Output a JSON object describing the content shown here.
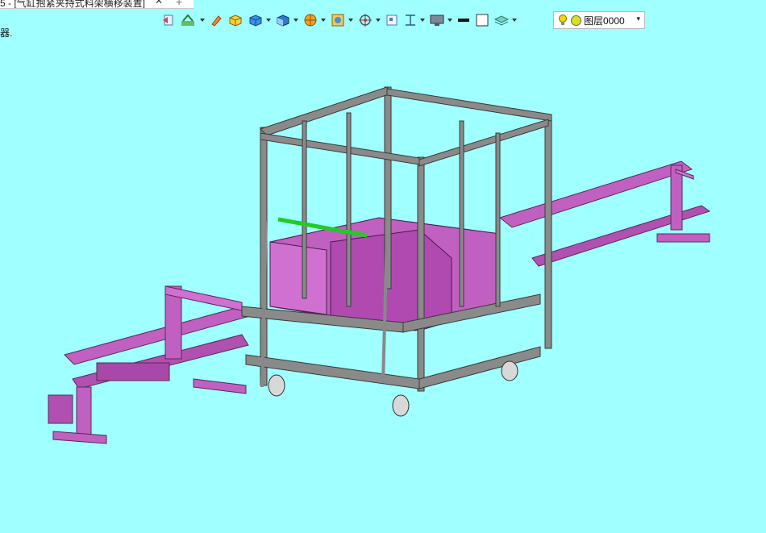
{
  "tab": {
    "title": "5 - [气缸抱紧夹持式料架横移装置]",
    "close_glyph": "✕",
    "new_glyph": "+"
  },
  "status_fragment": "器.",
  "toolbar": {
    "items": [
      "back-icon",
      "sketch-icon",
      "pencil-icon",
      "box-yellow-icon",
      "box-blue-icon",
      "box-shaded-icon",
      "render-icon",
      "display-icon",
      "target-icon",
      "square-icon",
      "dimension-icon",
      "monitor-icon",
      "line-weight-icon",
      "color-swatch-icon",
      "layers-icon"
    ]
  },
  "layer": {
    "name": "图层0000",
    "bulb_color": "#f2d60a",
    "dot_color": "#d4e31a",
    "dropdown_glyph": "▾"
  },
  "colors": {
    "background": "#a0ffff",
    "part_magenta": "#c060c0",
    "frame_gray": "#8a8a8a",
    "handle_green": "#22cc22"
  }
}
